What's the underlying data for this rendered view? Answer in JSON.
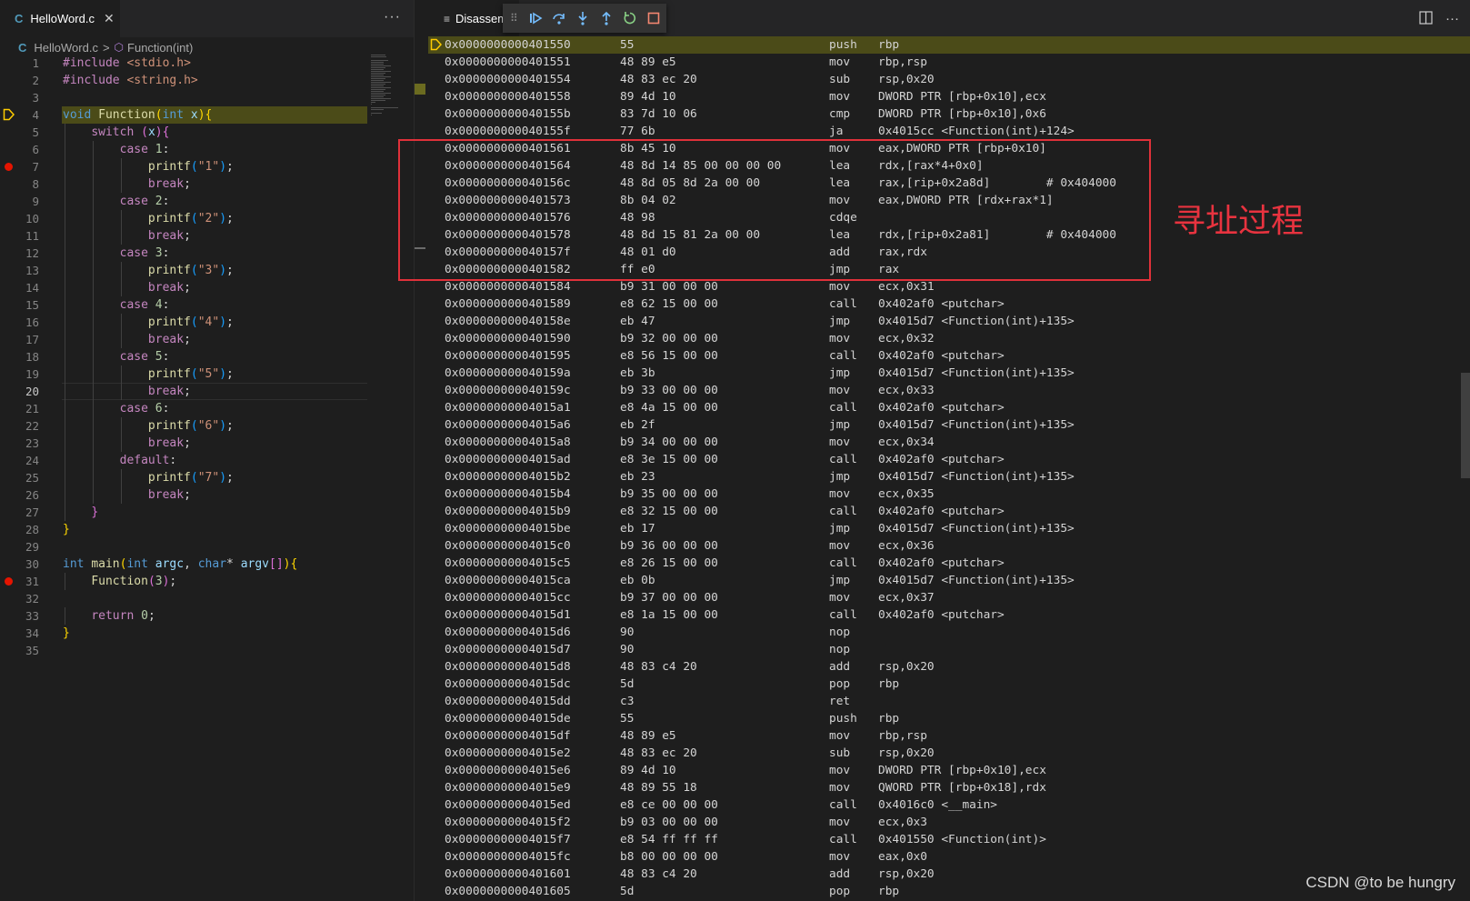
{
  "left_editor": {
    "tab_label": "HelloWord.c",
    "tab_icon": "C",
    "more_label": "···",
    "breadcrumb": {
      "file": "HelloWord.c",
      "separator": ">",
      "symbol": "Function(int)"
    },
    "lines": [
      {
        "n": "1",
        "segs": [
          [
            "c",
            "#include "
          ],
          [
            "s",
            "<stdio.h>"
          ]
        ]
      },
      {
        "n": "2",
        "segs": [
          [
            "c",
            "#include "
          ],
          [
            "s",
            "<string.h>"
          ]
        ]
      },
      {
        "n": "3",
        "segs": []
      },
      {
        "n": "4",
        "hl": true,
        "arrow": true,
        "segs": [
          [
            "k",
            "void "
          ],
          [
            "f",
            "Function"
          ],
          [
            "y",
            "("
          ],
          [
            "k",
            "int "
          ],
          [
            "v",
            "x"
          ],
          [
            "y",
            "){"
          ]
        ]
      },
      {
        "n": "5",
        "segs": [
          [
            "",
            "    "
          ],
          [
            "c",
            "switch "
          ],
          [
            "p",
            "("
          ],
          [
            "v",
            "x"
          ],
          [
            "p",
            "){"
          ]
        ]
      },
      {
        "n": "6",
        "segs": [
          [
            "",
            "        "
          ],
          [
            "c",
            "case "
          ],
          [
            "n",
            "1"
          ],
          [
            "",
            ":"
          ]
        ]
      },
      {
        "n": "7",
        "bp": true,
        "segs": [
          [
            "",
            "            "
          ],
          [
            "f",
            "printf"
          ],
          [
            "b",
            "("
          ],
          [
            "s",
            "\"1\""
          ],
          [
            "b",
            ")"
          ],
          [
            "",
            ";"
          ]
        ]
      },
      {
        "n": "8",
        "segs": [
          [
            "",
            "            "
          ],
          [
            "c",
            "break"
          ],
          [
            "",
            ";"
          ]
        ]
      },
      {
        "n": "9",
        "segs": [
          [
            "",
            "        "
          ],
          [
            "c",
            "case "
          ],
          [
            "n",
            "2"
          ],
          [
            "",
            ":"
          ]
        ]
      },
      {
        "n": "10",
        "segs": [
          [
            "",
            "            "
          ],
          [
            "f",
            "printf"
          ],
          [
            "b",
            "("
          ],
          [
            "s",
            "\"2\""
          ],
          [
            "b",
            ")"
          ],
          [
            "",
            ";"
          ]
        ]
      },
      {
        "n": "11",
        "segs": [
          [
            "",
            "            "
          ],
          [
            "c",
            "break"
          ],
          [
            "",
            ";"
          ]
        ]
      },
      {
        "n": "12",
        "segs": [
          [
            "",
            "        "
          ],
          [
            "c",
            "case "
          ],
          [
            "n",
            "3"
          ],
          [
            "",
            ":"
          ]
        ]
      },
      {
        "n": "13",
        "segs": [
          [
            "",
            "            "
          ],
          [
            "f",
            "printf"
          ],
          [
            "b",
            "("
          ],
          [
            "s",
            "\"3\""
          ],
          [
            "b",
            ")"
          ],
          [
            "",
            ";"
          ]
        ]
      },
      {
        "n": "14",
        "segs": [
          [
            "",
            "            "
          ],
          [
            "c",
            "break"
          ],
          [
            "",
            ";"
          ]
        ]
      },
      {
        "n": "15",
        "segs": [
          [
            "",
            "        "
          ],
          [
            "c",
            "case "
          ],
          [
            "n",
            "4"
          ],
          [
            "",
            ":"
          ]
        ]
      },
      {
        "n": "16",
        "segs": [
          [
            "",
            "            "
          ],
          [
            "f",
            "printf"
          ],
          [
            "b",
            "("
          ],
          [
            "s",
            "\"4\""
          ],
          [
            "b",
            ")"
          ],
          [
            "",
            ";"
          ]
        ]
      },
      {
        "n": "17",
        "segs": [
          [
            "",
            "            "
          ],
          [
            "c",
            "break"
          ],
          [
            "",
            ";"
          ]
        ]
      },
      {
        "n": "18",
        "segs": [
          [
            "",
            "        "
          ],
          [
            "c",
            "case "
          ],
          [
            "n",
            "5"
          ],
          [
            "",
            ":"
          ]
        ]
      },
      {
        "n": "19",
        "segs": [
          [
            "",
            "            "
          ],
          [
            "f",
            "printf"
          ],
          [
            "b",
            "("
          ],
          [
            "s",
            "\"5\""
          ],
          [
            "b",
            ")"
          ],
          [
            "",
            ";"
          ]
        ]
      },
      {
        "n": "20",
        "cur": true,
        "segs": [
          [
            "",
            "            "
          ],
          [
            "c",
            "break"
          ],
          [
            "",
            ";"
          ]
        ]
      },
      {
        "n": "21",
        "segs": [
          [
            "",
            "        "
          ],
          [
            "c",
            "case "
          ],
          [
            "n",
            "6"
          ],
          [
            "",
            ":"
          ]
        ]
      },
      {
        "n": "22",
        "segs": [
          [
            "",
            "            "
          ],
          [
            "f",
            "printf"
          ],
          [
            "b",
            "("
          ],
          [
            "s",
            "\"6\""
          ],
          [
            "b",
            ")"
          ],
          [
            "",
            ";"
          ]
        ]
      },
      {
        "n": "23",
        "segs": [
          [
            "",
            "            "
          ],
          [
            "c",
            "break"
          ],
          [
            "",
            ";"
          ]
        ]
      },
      {
        "n": "24",
        "segs": [
          [
            "",
            "        "
          ],
          [
            "c",
            "default"
          ],
          [
            "",
            ":"
          ]
        ]
      },
      {
        "n": "25",
        "segs": [
          [
            "",
            "            "
          ],
          [
            "f",
            "printf"
          ],
          [
            "b",
            "("
          ],
          [
            "s",
            "\"7\""
          ],
          [
            "b",
            ")"
          ],
          [
            "",
            ";"
          ]
        ]
      },
      {
        "n": "26",
        "segs": [
          [
            "",
            "            "
          ],
          [
            "c",
            "break"
          ],
          [
            "",
            ";"
          ]
        ]
      },
      {
        "n": "27",
        "segs": [
          [
            "",
            "    "
          ],
          [
            "p",
            "}"
          ]
        ]
      },
      {
        "n": "28",
        "segs": [
          [
            "y",
            "}"
          ]
        ]
      },
      {
        "n": "29",
        "segs": []
      },
      {
        "n": "30",
        "segs": [
          [
            "k",
            "int "
          ],
          [
            "f",
            "main"
          ],
          [
            "y",
            "("
          ],
          [
            "k",
            "int "
          ],
          [
            "v",
            "argc"
          ],
          [
            "",
            ", "
          ],
          [
            "k",
            "char"
          ],
          [
            "",
            "* "
          ],
          [
            "v",
            "argv"
          ],
          [
            "p",
            "[]"
          ],
          [
            "y",
            "){"
          ]
        ]
      },
      {
        "n": "31",
        "bp": true,
        "segs": [
          [
            "",
            "    "
          ],
          [
            "f",
            "Function"
          ],
          [
            "p",
            "("
          ],
          [
            "n",
            "3"
          ],
          [
            "p",
            ")"
          ],
          [
            "",
            ";"
          ]
        ]
      },
      {
        "n": "32",
        "segs": []
      },
      {
        "n": "33",
        "segs": [
          [
            "",
            "    "
          ],
          [
            "c",
            "return "
          ],
          [
            "n",
            "0"
          ],
          [
            "",
            ";"
          ]
        ]
      },
      {
        "n": "34",
        "segs": [
          [
            "y",
            "}"
          ]
        ]
      },
      {
        "n": "35",
        "segs": []
      }
    ]
  },
  "right_editor": {
    "tab_label": "Disassem",
    "debug_toolbar": [
      "continue-icon",
      "step-over-icon",
      "step-into-icon",
      "step-out-icon",
      "restart-icon",
      "stop-icon"
    ],
    "colors": {
      "continue": "#75beff",
      "restart": "#89d185",
      "stop": "#f48771"
    },
    "rows": [
      [
        "0x0000000000401550",
        "55",
        "push",
        "rbp"
      ],
      [
        "0x0000000000401551",
        "48 89 e5",
        "mov",
        "rbp,rsp"
      ],
      [
        "0x0000000000401554",
        "48 83 ec 20",
        "sub",
        "rsp,0x20"
      ],
      [
        "0x0000000000401558",
        "89 4d 10",
        "mov",
        "DWORD PTR [rbp+0x10],ecx"
      ],
      [
        "0x000000000040155b",
        "83 7d 10 06",
        "cmp",
        "DWORD PTR [rbp+0x10],0x6"
      ],
      [
        "0x000000000040155f",
        "77 6b",
        "ja",
        "0x4015cc <Function(int)+124>"
      ],
      [
        "0x0000000000401561",
        "8b 45 10",
        "mov",
        "eax,DWORD PTR [rbp+0x10]"
      ],
      [
        "0x0000000000401564",
        "48 8d 14 85 00 00 00 00",
        "lea",
        "rdx,[rax*4+0x0]"
      ],
      [
        "0x000000000040156c",
        "48 8d 05 8d 2a 00 00",
        "lea",
        "rax,[rip+0x2a8d]        # 0x404000"
      ],
      [
        "0x0000000000401573",
        "8b 04 02",
        "mov",
        "eax,DWORD PTR [rdx+rax*1]"
      ],
      [
        "0x0000000000401576",
        "48 98",
        "cdqe",
        ""
      ],
      [
        "0x0000000000401578",
        "48 8d 15 81 2a 00 00",
        "lea",
        "rdx,[rip+0x2a81]        # 0x404000"
      ],
      [
        "0x000000000040157f",
        "48 01 d0",
        "add",
        "rax,rdx"
      ],
      [
        "0x0000000000401582",
        "ff e0",
        "jmp",
        "rax"
      ],
      [
        "0x0000000000401584",
        "b9 31 00 00 00",
        "mov",
        "ecx,0x31"
      ],
      [
        "0x0000000000401589",
        "e8 62 15 00 00",
        "call",
        "0x402af0 <putchar>"
      ],
      [
        "0x000000000040158e",
        "eb 47",
        "jmp",
        "0x4015d7 <Function(int)+135>"
      ],
      [
        "0x0000000000401590",
        "b9 32 00 00 00",
        "mov",
        "ecx,0x32"
      ],
      [
        "0x0000000000401595",
        "e8 56 15 00 00",
        "call",
        "0x402af0 <putchar>"
      ],
      [
        "0x000000000040159a",
        "eb 3b",
        "jmp",
        "0x4015d7 <Function(int)+135>"
      ],
      [
        "0x000000000040159c",
        "b9 33 00 00 00",
        "mov",
        "ecx,0x33"
      ],
      [
        "0x00000000004015a1",
        "e8 4a 15 00 00",
        "call",
        "0x402af0 <putchar>"
      ],
      [
        "0x00000000004015a6",
        "eb 2f",
        "jmp",
        "0x4015d7 <Function(int)+135>"
      ],
      [
        "0x00000000004015a8",
        "b9 34 00 00 00",
        "mov",
        "ecx,0x34"
      ],
      [
        "0x00000000004015ad",
        "e8 3e 15 00 00",
        "call",
        "0x402af0 <putchar>"
      ],
      [
        "0x00000000004015b2",
        "eb 23",
        "jmp",
        "0x4015d7 <Function(int)+135>"
      ],
      [
        "0x00000000004015b4",
        "b9 35 00 00 00",
        "mov",
        "ecx,0x35"
      ],
      [
        "0x00000000004015b9",
        "e8 32 15 00 00",
        "call",
        "0x402af0 <putchar>"
      ],
      [
        "0x00000000004015be",
        "eb 17",
        "jmp",
        "0x4015d7 <Function(int)+135>"
      ],
      [
        "0x00000000004015c0",
        "b9 36 00 00 00",
        "mov",
        "ecx,0x36"
      ],
      [
        "0x00000000004015c5",
        "e8 26 15 00 00",
        "call",
        "0x402af0 <putchar>"
      ],
      [
        "0x00000000004015ca",
        "eb 0b",
        "jmp",
        "0x4015d7 <Function(int)+135>"
      ],
      [
        "0x00000000004015cc",
        "b9 37 00 00 00",
        "mov",
        "ecx,0x37"
      ],
      [
        "0x00000000004015d1",
        "e8 1a 15 00 00",
        "call",
        "0x402af0 <putchar>"
      ],
      [
        "0x00000000004015d6",
        "90",
        "nop",
        ""
      ],
      [
        "0x00000000004015d7",
        "90",
        "nop",
        ""
      ],
      [
        "0x00000000004015d8",
        "48 83 c4 20",
        "add",
        "rsp,0x20"
      ],
      [
        "0x00000000004015dc",
        "5d",
        "pop",
        "rbp"
      ],
      [
        "0x00000000004015dd",
        "c3",
        "ret",
        ""
      ],
      [
        "0x00000000004015de",
        "55",
        "push",
        "rbp"
      ],
      [
        "0x00000000004015df",
        "48 89 e5",
        "mov",
        "rbp,rsp"
      ],
      [
        "0x00000000004015e2",
        "48 83 ec 20",
        "sub",
        "rsp,0x20"
      ],
      [
        "0x00000000004015e6",
        "89 4d 10",
        "mov",
        "DWORD PTR [rbp+0x10],ecx"
      ],
      [
        "0x00000000004015e9",
        "48 89 55 18",
        "mov",
        "QWORD PTR [rbp+0x18],rdx"
      ],
      [
        "0x00000000004015ed",
        "e8 ce 00 00 00",
        "call",
        "0x4016c0 <__main>"
      ],
      [
        "0x00000000004015f2",
        "b9 03 00 00 00",
        "mov",
        "ecx,0x3"
      ],
      [
        "0x00000000004015f7",
        "e8 54 ff ff ff",
        "call",
        "0x401550 <Function(int)>"
      ],
      [
        "0x00000000004015fc",
        "b8 00 00 00 00",
        "mov",
        "eax,0x0"
      ],
      [
        "0x0000000000401601",
        "48 83 c4 20",
        "add",
        "rsp,0x20"
      ],
      [
        "0x0000000000401605",
        "5d",
        "pop",
        "rbp"
      ]
    ]
  },
  "annotation": {
    "text": "寻址过程",
    "color": "#e8333f"
  },
  "watermark": "CSDN @to be hungry"
}
